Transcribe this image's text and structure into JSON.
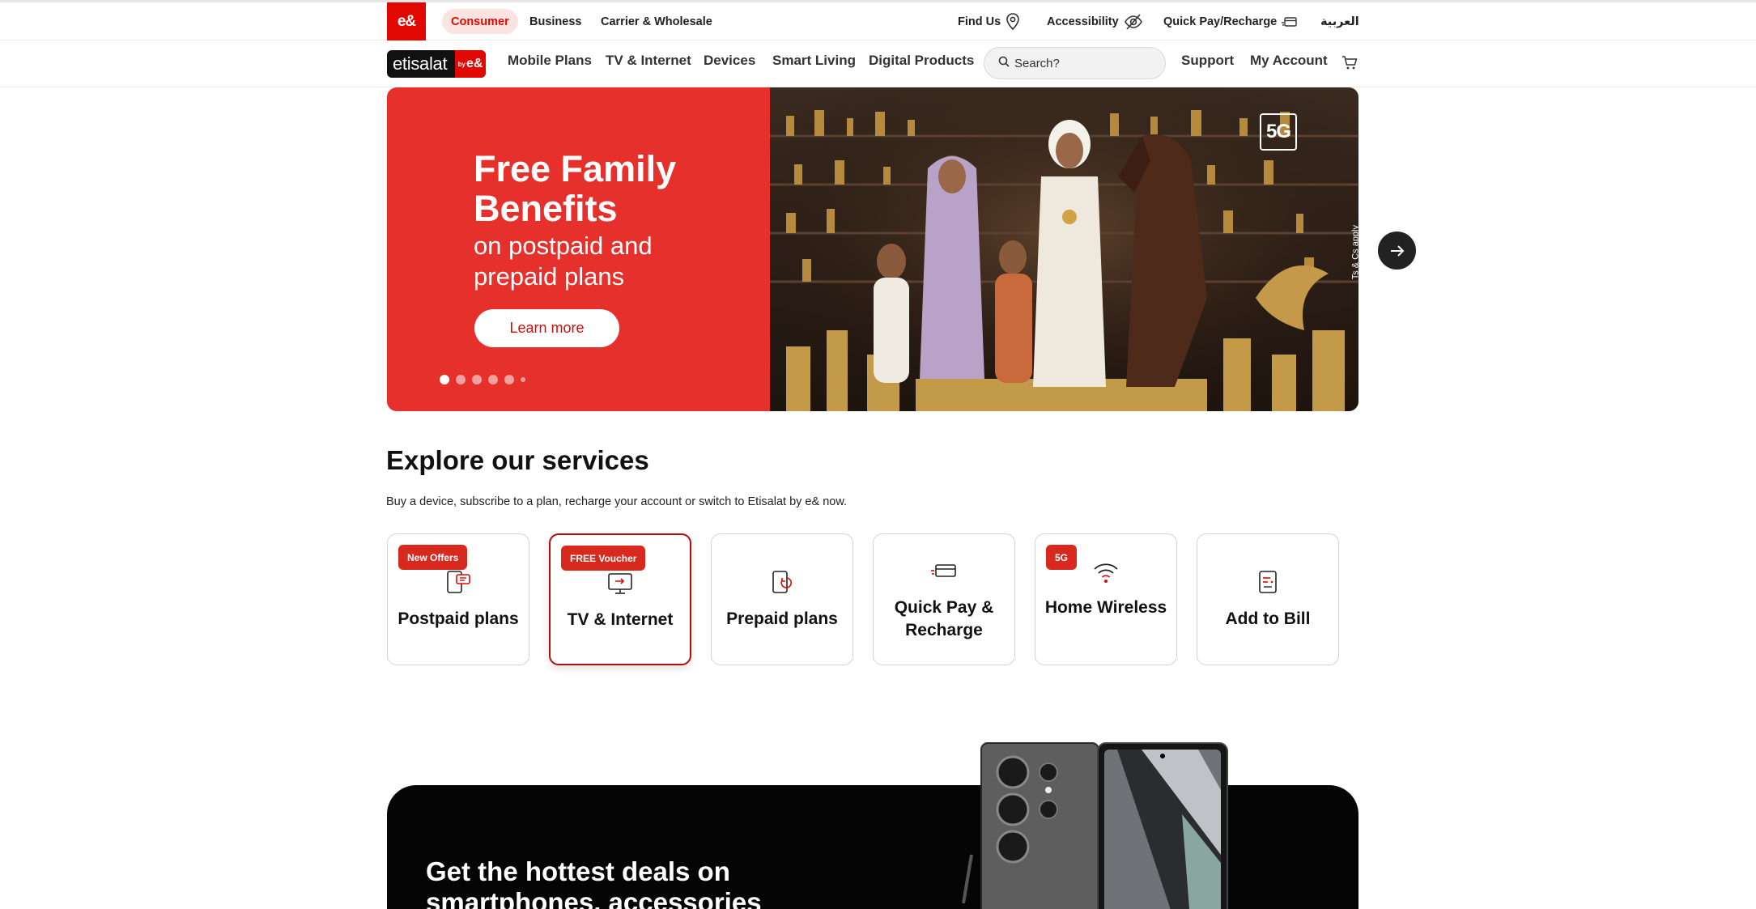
{
  "utility": {
    "logo": "e&",
    "segments": [
      "Consumer",
      "Business",
      "Carrier & Wholesale"
    ],
    "find_us": "Find Us",
    "accessibility": "Accessibility",
    "quick_pay": "Quick Pay/Recharge",
    "language": "العربية"
  },
  "nav": {
    "brand_word": "etisalat",
    "brand_by": "by",
    "brand_mark": "e&",
    "links": [
      "Mobile Plans",
      "TV & Internet",
      "Devices",
      "Smart Living",
      "Digital Products"
    ],
    "search_placeholder": "Search?",
    "support": "Support",
    "my_account": "My Account"
  },
  "hero": {
    "title": "Free Family Benefits",
    "subtitle": "on postpaid and prepaid plans",
    "cta": "Learn more",
    "badge": "5G",
    "terms": "Ts & Cs apply",
    "slide_count": 6,
    "active_slide": 1
  },
  "services": {
    "title": "Explore our services",
    "description": "Buy a device, subscribe to a plan, recharge your account or switch to Etisalat by e& now.",
    "cards": [
      {
        "label": "Postpaid plans",
        "tag": "New Offers",
        "icon": "phone-chat-icon"
      },
      {
        "label": "TV & Internet",
        "tag": "FREE Voucher",
        "icon": "tv-icon"
      },
      {
        "label": "Prepaid plans",
        "tag": "",
        "icon": "phone-refresh-icon"
      },
      {
        "label": "Quick Pay & Recharge",
        "tag": "",
        "icon": "card-icon"
      },
      {
        "label": "Home Wireless",
        "tag": "5G",
        "icon": "wifi-icon"
      },
      {
        "label": "Add to Bill",
        "tag": "",
        "icon": "bill-icon"
      }
    ]
  },
  "promo": {
    "title": "Get the hottest deals on smartphones, accessories"
  },
  "colors": {
    "brand_red": "#e00800",
    "hero_red": "#e5302c",
    "tag_red": "#d8291f"
  }
}
